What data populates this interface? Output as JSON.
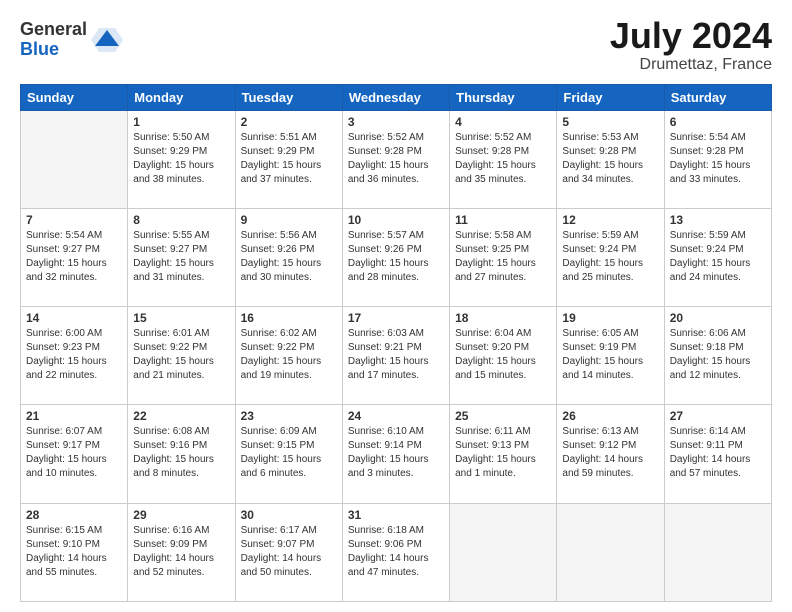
{
  "header": {
    "logo_general": "General",
    "logo_blue": "Blue",
    "main_title": "July 2024",
    "subtitle": "Drumettaz, France"
  },
  "calendar": {
    "days_of_week": [
      "Sunday",
      "Monday",
      "Tuesday",
      "Wednesday",
      "Thursday",
      "Friday",
      "Saturday"
    ],
    "weeks": [
      [
        {
          "day": "",
          "info": ""
        },
        {
          "day": "1",
          "info": "Sunrise: 5:50 AM\nSunset: 9:29 PM\nDaylight: 15 hours\nand 38 minutes."
        },
        {
          "day": "2",
          "info": "Sunrise: 5:51 AM\nSunset: 9:29 PM\nDaylight: 15 hours\nand 37 minutes."
        },
        {
          "day": "3",
          "info": "Sunrise: 5:52 AM\nSunset: 9:28 PM\nDaylight: 15 hours\nand 36 minutes."
        },
        {
          "day": "4",
          "info": "Sunrise: 5:52 AM\nSunset: 9:28 PM\nDaylight: 15 hours\nand 35 minutes."
        },
        {
          "day": "5",
          "info": "Sunrise: 5:53 AM\nSunset: 9:28 PM\nDaylight: 15 hours\nand 34 minutes."
        },
        {
          "day": "6",
          "info": "Sunrise: 5:54 AM\nSunset: 9:28 PM\nDaylight: 15 hours\nand 33 minutes."
        }
      ],
      [
        {
          "day": "7",
          "info": "Sunrise: 5:54 AM\nSunset: 9:27 PM\nDaylight: 15 hours\nand 32 minutes."
        },
        {
          "day": "8",
          "info": "Sunrise: 5:55 AM\nSunset: 9:27 PM\nDaylight: 15 hours\nand 31 minutes."
        },
        {
          "day": "9",
          "info": "Sunrise: 5:56 AM\nSunset: 9:26 PM\nDaylight: 15 hours\nand 30 minutes."
        },
        {
          "day": "10",
          "info": "Sunrise: 5:57 AM\nSunset: 9:26 PM\nDaylight: 15 hours\nand 28 minutes."
        },
        {
          "day": "11",
          "info": "Sunrise: 5:58 AM\nSunset: 9:25 PM\nDaylight: 15 hours\nand 27 minutes."
        },
        {
          "day": "12",
          "info": "Sunrise: 5:59 AM\nSunset: 9:24 PM\nDaylight: 15 hours\nand 25 minutes."
        },
        {
          "day": "13",
          "info": "Sunrise: 5:59 AM\nSunset: 9:24 PM\nDaylight: 15 hours\nand 24 minutes."
        }
      ],
      [
        {
          "day": "14",
          "info": "Sunrise: 6:00 AM\nSunset: 9:23 PM\nDaylight: 15 hours\nand 22 minutes."
        },
        {
          "day": "15",
          "info": "Sunrise: 6:01 AM\nSunset: 9:22 PM\nDaylight: 15 hours\nand 21 minutes."
        },
        {
          "day": "16",
          "info": "Sunrise: 6:02 AM\nSunset: 9:22 PM\nDaylight: 15 hours\nand 19 minutes."
        },
        {
          "day": "17",
          "info": "Sunrise: 6:03 AM\nSunset: 9:21 PM\nDaylight: 15 hours\nand 17 minutes."
        },
        {
          "day": "18",
          "info": "Sunrise: 6:04 AM\nSunset: 9:20 PM\nDaylight: 15 hours\nand 15 minutes."
        },
        {
          "day": "19",
          "info": "Sunrise: 6:05 AM\nSunset: 9:19 PM\nDaylight: 15 hours\nand 14 minutes."
        },
        {
          "day": "20",
          "info": "Sunrise: 6:06 AM\nSunset: 9:18 PM\nDaylight: 15 hours\nand 12 minutes."
        }
      ],
      [
        {
          "day": "21",
          "info": "Sunrise: 6:07 AM\nSunset: 9:17 PM\nDaylight: 15 hours\nand 10 minutes."
        },
        {
          "day": "22",
          "info": "Sunrise: 6:08 AM\nSunset: 9:16 PM\nDaylight: 15 hours\nand 8 minutes."
        },
        {
          "day": "23",
          "info": "Sunrise: 6:09 AM\nSunset: 9:15 PM\nDaylight: 15 hours\nand 6 minutes."
        },
        {
          "day": "24",
          "info": "Sunrise: 6:10 AM\nSunset: 9:14 PM\nDaylight: 15 hours\nand 3 minutes."
        },
        {
          "day": "25",
          "info": "Sunrise: 6:11 AM\nSunset: 9:13 PM\nDaylight: 15 hours\nand 1 minute."
        },
        {
          "day": "26",
          "info": "Sunrise: 6:13 AM\nSunset: 9:12 PM\nDaylight: 14 hours\nand 59 minutes."
        },
        {
          "day": "27",
          "info": "Sunrise: 6:14 AM\nSunset: 9:11 PM\nDaylight: 14 hours\nand 57 minutes."
        }
      ],
      [
        {
          "day": "28",
          "info": "Sunrise: 6:15 AM\nSunset: 9:10 PM\nDaylight: 14 hours\nand 55 minutes."
        },
        {
          "day": "29",
          "info": "Sunrise: 6:16 AM\nSunset: 9:09 PM\nDaylight: 14 hours\nand 52 minutes."
        },
        {
          "day": "30",
          "info": "Sunrise: 6:17 AM\nSunset: 9:07 PM\nDaylight: 14 hours\nand 50 minutes."
        },
        {
          "day": "31",
          "info": "Sunrise: 6:18 AM\nSunset: 9:06 PM\nDaylight: 14 hours\nand 47 minutes."
        },
        {
          "day": "",
          "info": ""
        },
        {
          "day": "",
          "info": ""
        },
        {
          "day": "",
          "info": ""
        }
      ]
    ]
  }
}
